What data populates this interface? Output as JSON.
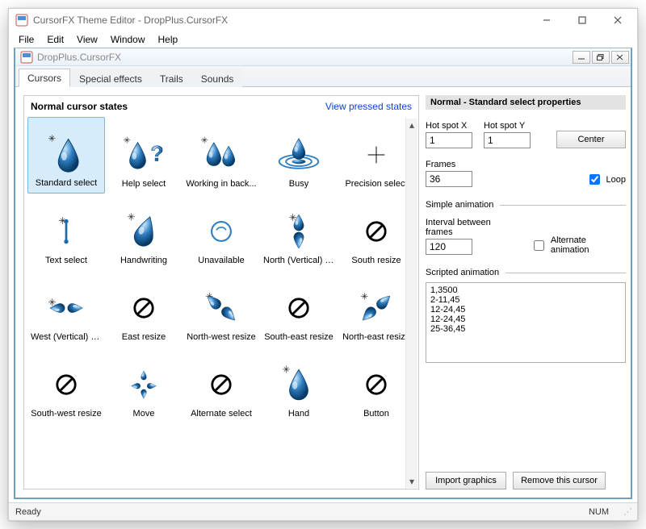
{
  "window": {
    "title": "CursorFX Theme Editor - DropPlus.CursorFX"
  },
  "menu": {
    "file": "File",
    "edit": "Edit",
    "view": "View",
    "window": "Window",
    "help": "Help"
  },
  "mdi": {
    "title": "DropPlus.CursorFX"
  },
  "tabs": {
    "cursors": "Cursors",
    "special_effects": "Special effects",
    "trails": "Trails",
    "sounds": "Sounds"
  },
  "left": {
    "heading": "Normal cursor states",
    "view_pressed": "View pressed states"
  },
  "cursors": [
    {
      "label": "Standard select",
      "icon": "drop"
    },
    {
      "label": "Help select",
      "icon": "drop-question"
    },
    {
      "label": "Working in back...",
      "icon": "drop-pair"
    },
    {
      "label": "Busy",
      "icon": "ripple"
    },
    {
      "label": "Precision select",
      "icon": "cross"
    },
    {
      "label": "Text select",
      "icon": "ibeam"
    },
    {
      "label": "Handwriting",
      "icon": "pen-drop"
    },
    {
      "label": "Unavailable",
      "icon": "circle-outline"
    },
    {
      "label": "North (Vertical) r...",
      "icon": "double-drop-v"
    },
    {
      "label": "South resize",
      "icon": "forbid"
    },
    {
      "label": "West (Vertical) re...",
      "icon": "double-drop-h"
    },
    {
      "label": "East resize",
      "icon": "forbid"
    },
    {
      "label": "North-west resize",
      "icon": "diag-drops"
    },
    {
      "label": "South-east resize",
      "icon": "forbid"
    },
    {
      "label": "North-east resize",
      "icon": "diag-drops2"
    },
    {
      "label": "South-west resize",
      "icon": "forbid"
    },
    {
      "label": "Move",
      "icon": "four-drops"
    },
    {
      "label": "Alternate select",
      "icon": "forbid"
    },
    {
      "label": "Hand",
      "icon": "big-drop"
    },
    {
      "label": "Button",
      "icon": "forbid"
    }
  ],
  "props": {
    "title": "Normal - Standard select properties",
    "hotspot_x_label": "Hot spot X",
    "hotspot_x_value": "1",
    "hotspot_y_label": "Hot spot Y",
    "hotspot_y_value": "1",
    "center": "Center",
    "frames_label": "Frames",
    "frames_value": "36",
    "loop_label": "Loop",
    "simple_anim": "Simple animation",
    "interval_label": "Interval between frames",
    "interval_value": "120",
    "alt_anim_label": "Alternate animation",
    "scripted_anim": "Scripted animation",
    "script": "1,3500\n2-11,45\n12-24,45\n12-24,45\n25-36,45",
    "import_graphics": "Import graphics",
    "remove_cursor": "Remove this cursor"
  },
  "status": {
    "ready": "Ready",
    "num": "NUM"
  }
}
